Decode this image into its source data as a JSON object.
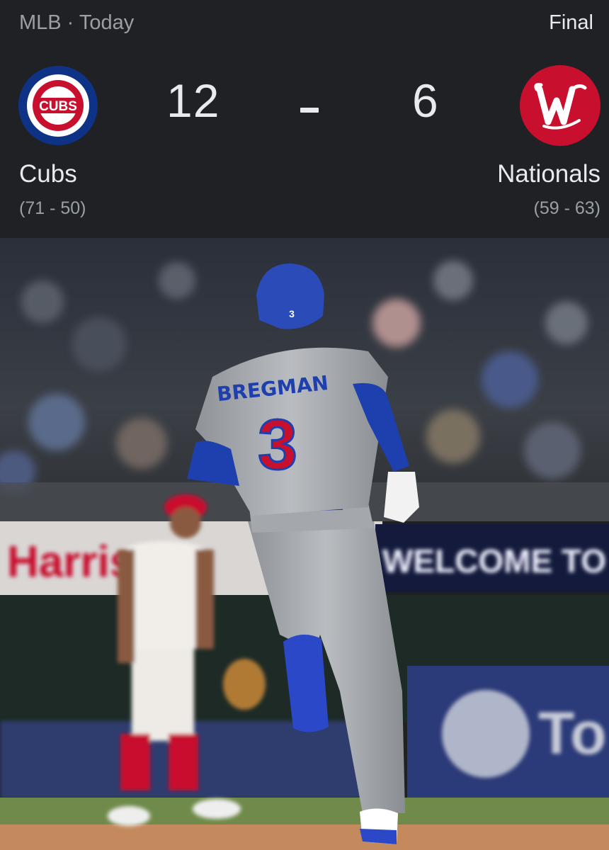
{
  "header": {
    "league": "MLB · Today",
    "status": "Final"
  },
  "home_team": {
    "name": "Cubs",
    "score": "12",
    "record": "(71 - 50)",
    "logo_text": "CUBS",
    "logo_icon": "cubs-logo-icon",
    "color": "#0e3386"
  },
  "away_team": {
    "name": "Nationals",
    "score": "6",
    "record": "(59 - 63)",
    "logo_icon": "nationals-logo-icon",
    "color": "#c8102e"
  },
  "photo": {
    "jersey_name": "BREGMAN",
    "jersey_number": "3",
    "helmet_number": "3",
    "board_left": "Harris",
    "board_right": "WELCOME TO N",
    "sign_right": "To"
  }
}
